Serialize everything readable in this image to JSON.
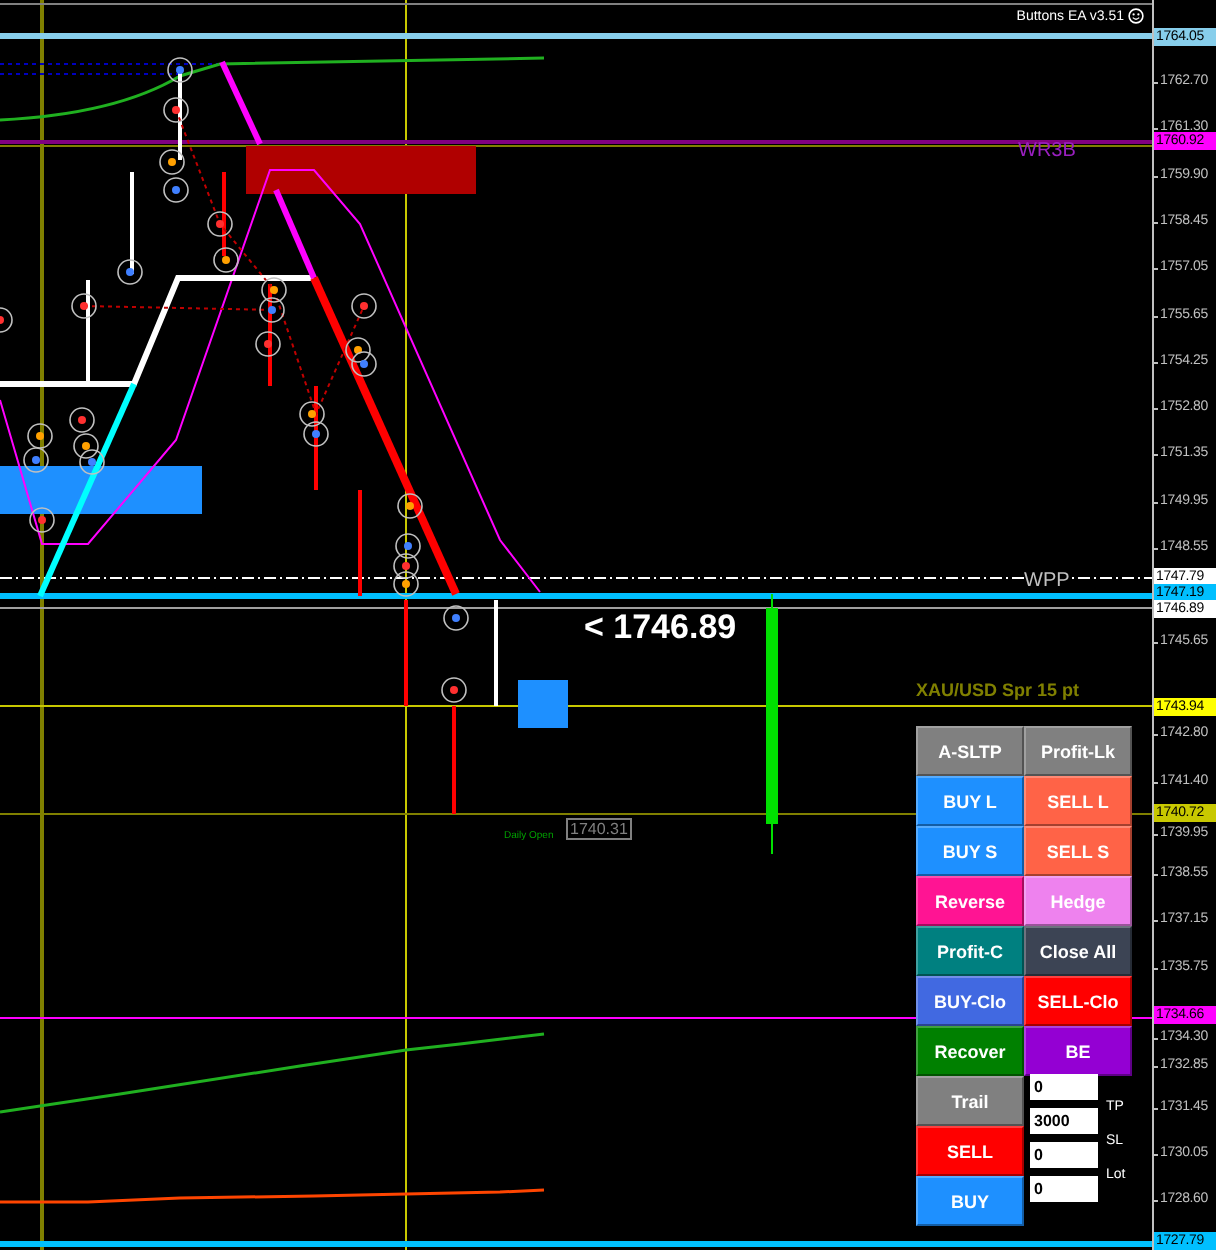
{
  "header": {
    "title": "Buttons EA v3.51"
  },
  "price_axis": {
    "ticks": [
      "1762.70",
      "1761.30",
      "1759.90",
      "1758.45",
      "1757.05",
      "1755.65",
      "1754.25",
      "1752.80",
      "1751.35",
      "1749.95",
      "1748.55",
      "1745.65",
      "1742.80",
      "1741.40",
      "1739.95",
      "1738.55",
      "1737.15",
      "1735.75",
      "1734.30",
      "1732.85",
      "1731.45",
      "1730.05",
      "1728.60"
    ],
    "tags": [
      {
        "text": "1764.05",
        "color": "#87ceeb"
      },
      {
        "text": "1760.92",
        "color": "#ff00ff"
      },
      {
        "text": "1747.79",
        "color": "#ffffff"
      },
      {
        "text": "1747.19",
        "color": "#00bfff"
      },
      {
        "text": "1746.89",
        "color": "#ffffff"
      },
      {
        "text": "1743.94",
        "color": "#ffff00"
      },
      {
        "text": "1740.72",
        "color": "#c8c800"
      },
      {
        "text": "1734.66",
        "color": "#ff00ff"
      },
      {
        "text": "1727.79",
        "color": "#00bfff"
      }
    ]
  },
  "chart_labels": [
    {
      "kind": "resistance",
      "text": "WR3B"
    },
    {
      "kind": "pivot",
      "text": "WPP"
    },
    {
      "kind": "bid",
      "text": "<  1746.89"
    },
    {
      "kind": "spread",
      "text": "XAU/USD Spr 15 pt"
    },
    {
      "kind": "daily-open",
      "text": "Daily Open"
    },
    {
      "kind": "open-price",
      "text": "1740.31"
    }
  ],
  "buttons": [
    {
      "label": "A-SLTP",
      "color": "#808080"
    },
    {
      "label": "Profit-Lk",
      "color": "#808080"
    },
    {
      "label": "BUY L",
      "color": "#1e90ff"
    },
    {
      "label": "SELL L",
      "color": "#ff6347"
    },
    {
      "label": "BUY S",
      "color": "#1e90ff"
    },
    {
      "label": "SELL S",
      "color": "#ff6347"
    },
    {
      "label": "Reverse",
      "color": "#ff1493"
    },
    {
      "label": "Hedge",
      "color": "#ee82ee"
    },
    {
      "label": "Profit-C",
      "color": "#008080"
    },
    {
      "label": "Close All",
      "color": "#3c4454"
    },
    {
      "label": "BUY-Clo",
      "color": "#4169e1"
    },
    {
      "label": "SELL-Clo",
      "color": "#ff0000"
    },
    {
      "label": "Recover",
      "color": "#008000"
    },
    {
      "label": "BE",
      "color": "#9400d3"
    }
  ],
  "side_buttons": [
    {
      "label": "Trail",
      "color": "#808080"
    },
    {
      "label": "SELL",
      "color": "#ff0000"
    },
    {
      "label": "BUY",
      "color": "#1e90ff"
    }
  ],
  "fields": [
    {
      "value": "0"
    },
    {
      "value": "3000",
      "label": "TP"
    },
    {
      "value": "0",
      "label": "SL"
    },
    {
      "value": "0",
      "label": "Lot"
    }
  ]
}
